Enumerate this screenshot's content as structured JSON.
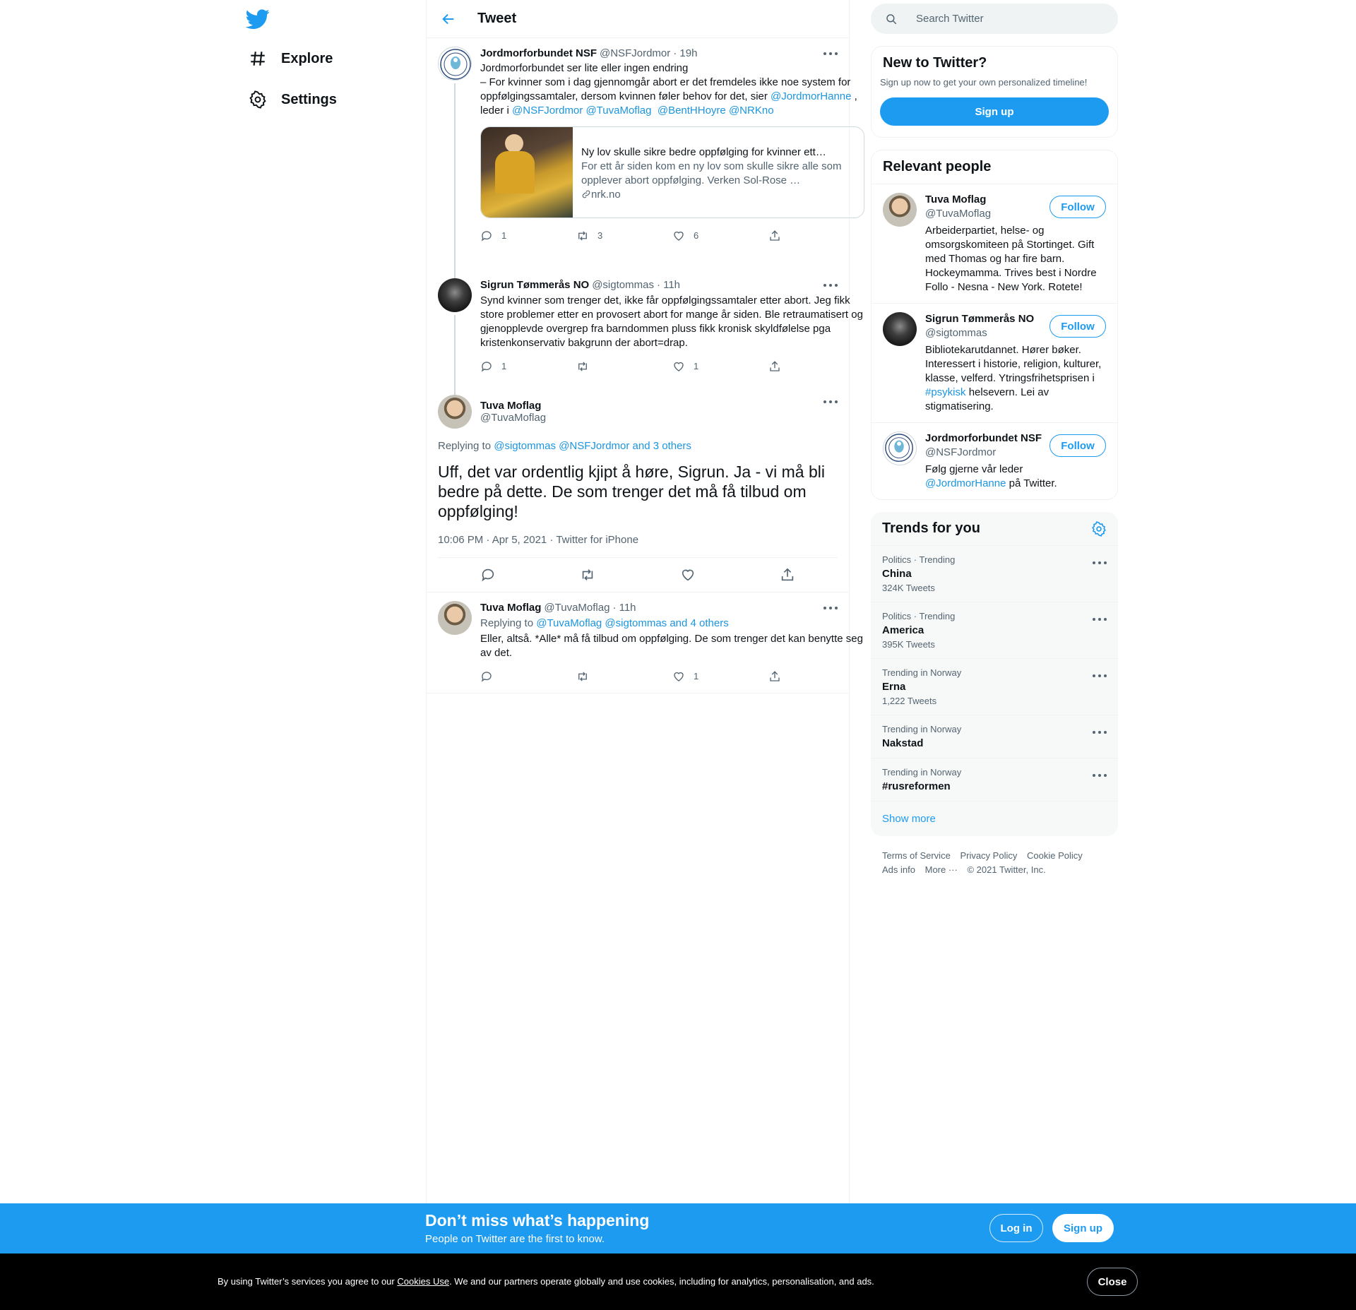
{
  "nav": {
    "explore": "Explore",
    "settings": "Settings"
  },
  "header": {
    "title": "Tweet"
  },
  "tweets": [
    {
      "name": "Jordmorforbundet NSF",
      "handle": "@NSFJordmor",
      "time": "· 19h",
      "text_line1": "Jordmorforbundet ser lite eller ingen endring",
      "text_line2": "– For kvinner som i dag gjennomgår abort er det fremdeles ikke noe system for oppfølgingssamtaler, dersom kvinnen føler behov for det, sier",
      "mention1": "@JordmorHanne",
      "text_mid": " , leder i ",
      "mention2": "@NSFJordmor",
      "mention3": "@TuvaMoflag",
      "mention4": "@BentHHoyre",
      "mention5": "@NRKno",
      "card": {
        "title": "Ny lov skulle sikre bedre oppfølging for kvinner etter abort",
        "desc": "For ett år siden kom en ny lov som skulle sikre alle som opplever abort oppfølging. Verken Sol-Rose …",
        "link": "nrk.no"
      },
      "replies": "1",
      "retweets": "3",
      "likes": "6"
    },
    {
      "name": "Sigrun Tømmerås NO",
      "handle": "@sigtommas",
      "time": "· 11h",
      "text": "Synd kvinner som trenger det, ikke får oppfølgingssamtaler etter abort. Jeg fikk store problemer etter en provosert abort for mange år siden. Ble retraumatisert og gjenopplevde overgrep fra barndommen pluss fikk kronisk skyldfølelse pga kristenkonservativ bakgrunn der abort=drap.",
      "replies": "1",
      "retweets": "",
      "likes": "1"
    }
  ],
  "focus": {
    "name": "Tuva Moflag",
    "handle": "@TuvaMoflag",
    "replying_prefix": "Replying to ",
    "replying_mentions": "@sigtommas @NSFJordmor and 3 others",
    "text": "Uff, det var ordentlig kjipt å høre, Sigrun. Ja - vi må bli bedre på dette. De som trenger det må få tilbud om oppfølging!",
    "meta": "10:06 PM · Apr 5, 2021 · Twitter for iPhone"
  },
  "reply": {
    "name": "Tuva Moflag",
    "handle": "@TuvaMoflag",
    "time": "· 11h",
    "replying_prefix": "Replying to ",
    "replying_mentions": "@TuvaMoflag @sigtommas and 4 others",
    "text": "Eller, altså. *Alle* må få tilbud om oppfølging. De som trenger det kan benytte seg av det.",
    "replies": "",
    "retweets": "",
    "likes": "1"
  },
  "search": {
    "placeholder": "Search Twitter"
  },
  "signup_panel": {
    "title": "New to Twitter?",
    "sub": "Sign up now to get your own personalized timeline!",
    "button": "Sign up"
  },
  "relevant": {
    "title": "Relevant people",
    "follow": "Follow",
    "people": [
      {
        "name": "Tuva Moflag",
        "handle": "@TuvaMoflag",
        "bio": "Arbeiderpartiet, helse- og omsorgskomiteen på Stortinget. Gift med Thomas og har fire barn. Hockeymamma. Trives best i Nordre Follo - Nesna - New York. Rotete!"
      },
      {
        "name": "Sigrun Tømmerås NO",
        "handle": "@sigtommas",
        "bio_pre": "Bibliotekarutdannet. Hører bøker. Interessert i historie, religion, kulturer, klasse, velferd. Ytringsfrihetsprisen i ",
        "bio_tag": "#psykisk",
        "bio_post": " helsevern. Lei av stigmatisering."
      },
      {
        "name": "Jordmorforbundet NSF",
        "handle": "@NSFJordmor",
        "bio_pre": "Følg gjerne vår leder ",
        "bio_tag": "@JordmorHanne",
        "bio_post": " på Twitter."
      }
    ]
  },
  "trends": {
    "title": "Trends for you",
    "items": [
      {
        "ctx": "Politics · Trending",
        "name": "China",
        "count": "324K Tweets"
      },
      {
        "ctx": "Politics · Trending",
        "name": "America",
        "count": "395K Tweets"
      },
      {
        "ctx": "Trending in Norway",
        "name": "Erna",
        "count": "1,222 Tweets"
      },
      {
        "ctx": "Trending in Norway",
        "name": "Nakstad",
        "count": ""
      },
      {
        "ctx": "Trending in Norway",
        "name": "#rusreformen",
        "count": ""
      }
    ],
    "show_more": "Show more"
  },
  "footer": {
    "terms": "Terms of Service",
    "privacy": "Privacy Policy",
    "cookie": "Cookie Policy",
    "ads": "Ads info",
    "more": "More ···",
    "copyright": "© 2021 Twitter, Inc."
  },
  "cta": {
    "title": "Don’t miss what’s happening",
    "sub": "People on Twitter are the first to know.",
    "login": "Log in",
    "signup": "Sign up"
  },
  "cookie": {
    "pre": "By using Twitter’s services you agree to our ",
    "link": "Cookies Use",
    "post": ". We and our partners operate globally and use cookies, including for analytics, personalisation, and ads.",
    "close": "Close"
  },
  "colors": {
    "accent": "#1d9bf0",
    "text": "#0f1419",
    "muted": "#536471"
  }
}
